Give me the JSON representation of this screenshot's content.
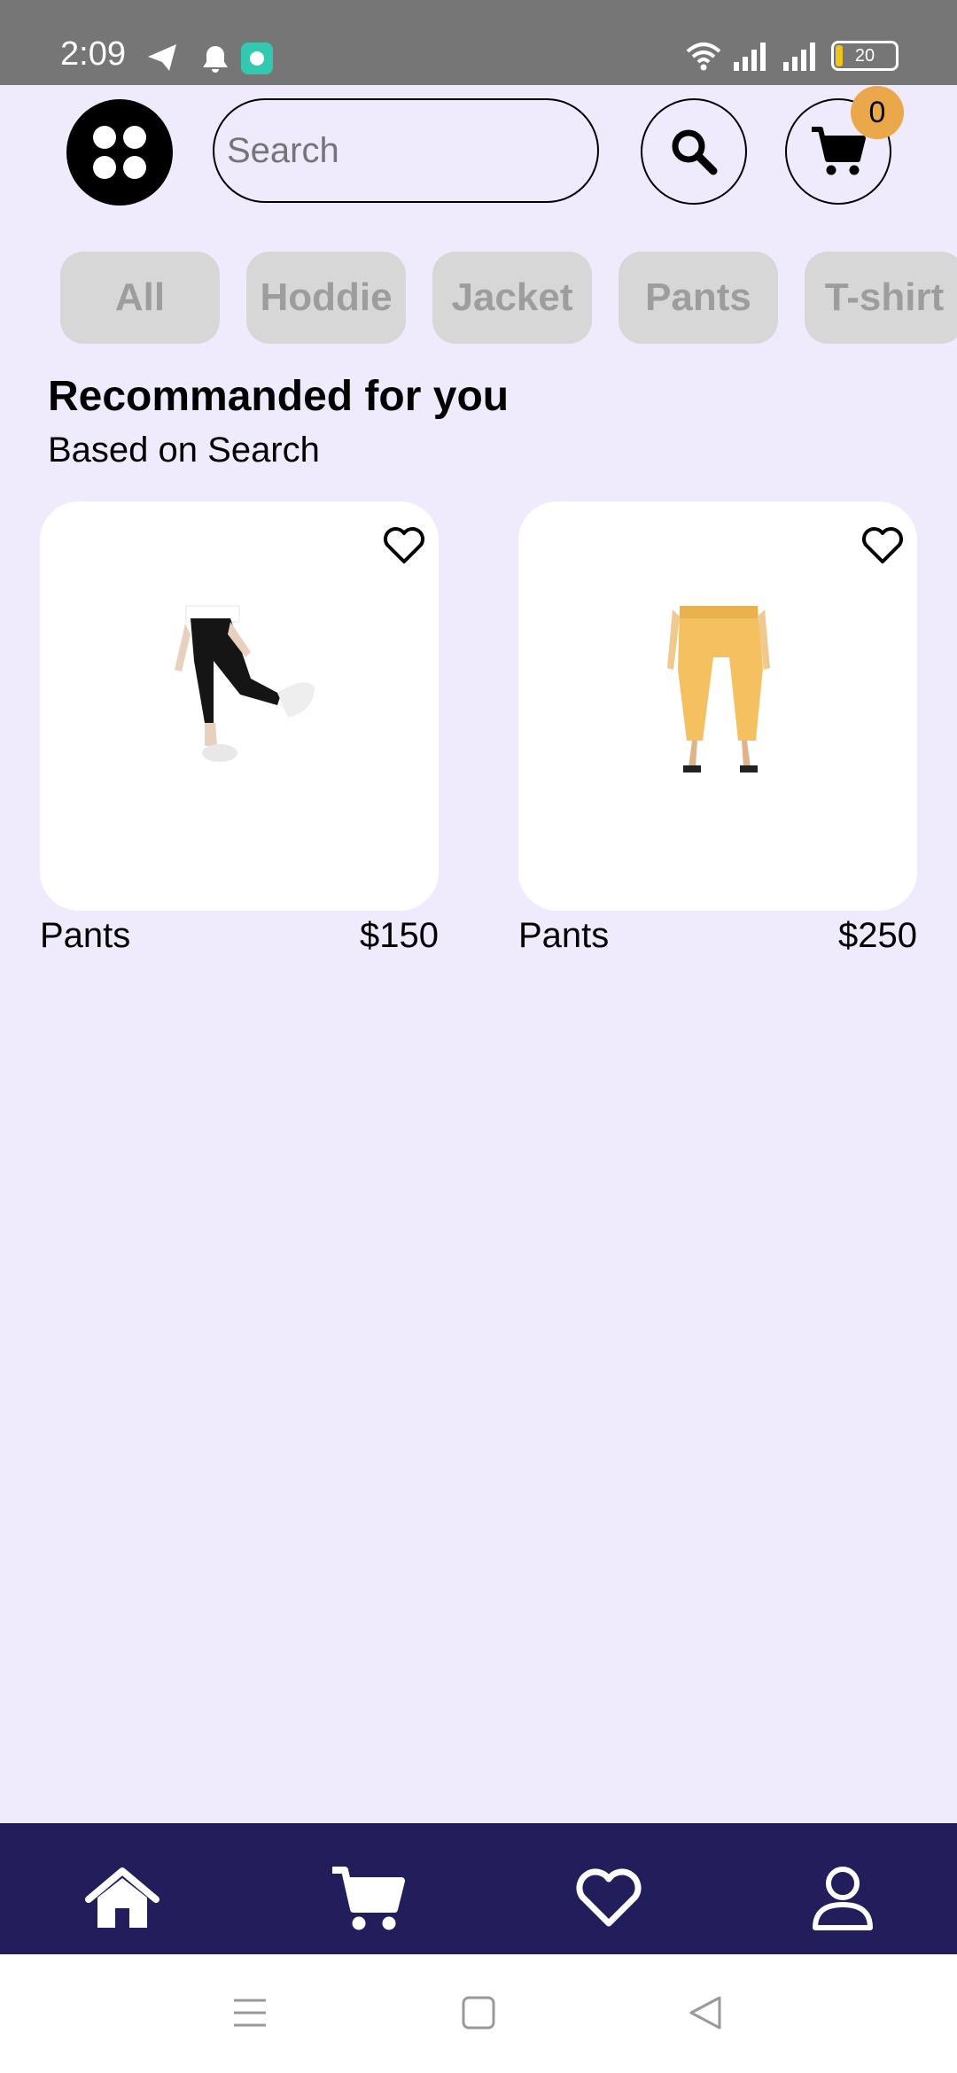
{
  "status_bar": {
    "time": "2:09",
    "battery": "20"
  },
  "header": {
    "search_placeholder": "Search",
    "cart_count": "0"
  },
  "categories": [
    "All",
    "Hoddie",
    "Jacket",
    "Pants",
    "T-shirt"
  ],
  "section": {
    "title": "Recommanded for you",
    "subtitle": "Based on Search"
  },
  "products": [
    {
      "name": "Pants",
      "price": "$150"
    },
    {
      "name": "Pants",
      "price": "$250"
    }
  ],
  "colors": {
    "background": "#efebfd",
    "nav_background": "#221e5b",
    "badge": "#eaa84a",
    "chip": "#d7d7d7"
  },
  "icons": {
    "bottom_nav": [
      "home-icon",
      "cart-icon",
      "heart-icon",
      "user-icon"
    ],
    "system_nav": [
      "menu-lines-icon",
      "square-icon",
      "back-triangle-icon"
    ]
  }
}
